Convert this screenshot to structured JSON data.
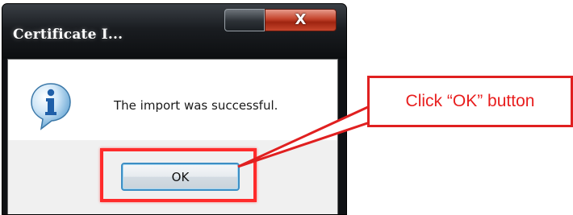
{
  "dialog": {
    "title": "Certificate I...",
    "close_glyph": "X",
    "message": "The import was successful.",
    "icon": "info-icon",
    "ok_label": "OK"
  },
  "annotation": {
    "callout_text": "Click “OK” button",
    "color": "#e81e1e"
  }
}
